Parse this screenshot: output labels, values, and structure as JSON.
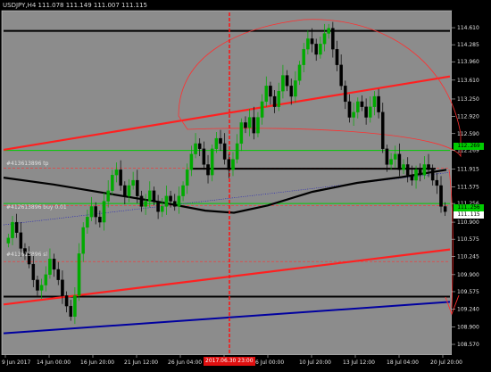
{
  "window": {
    "title": "USDJPY,H4  111.078 111.149 111.007 111.115"
  },
  "colors": {
    "background": "#000000",
    "plot_background": "#8c8c8c",
    "candle_up": "#00aa00",
    "candle_down": "#000000",
    "channel_red": "#ff2020",
    "level_green": "#00cc00",
    "level_black": "#000000",
    "trend_blue": "#0000a0",
    "moving_average": "#000000"
  },
  "order_labels": {
    "tp": "#413613896 tp",
    "buy": "#412613896 buy  0.01",
    "sl": "#413613896 sl"
  },
  "current_price_tags": {
    "upper_green": "112.269",
    "lower_green": "111.256",
    "bid": "111.115"
  },
  "cursor_time_label": "2017.06.30 23:00",
  "chart_data": {
    "type": "candlestick",
    "symbol": "USDJPY",
    "timeframe": "H4",
    "ohlc_header": {
      "open": 111.078,
      "high": 111.149,
      "low": 111.007,
      "close": 111.115
    },
    "y_ticks": [
      "114.610",
      "114.285",
      "113.960",
      "113.610",
      "113.250",
      "112.920",
      "112.590",
      "112.269",
      "111.915",
      "111.575",
      "111.256",
      "110.900",
      "110.575",
      "110.245",
      "109.900",
      "109.575",
      "109.240",
      "108.900",
      "108.570"
    ],
    "x_ticks": [
      "9 Jun 2017",
      "14 Jun 00:00",
      "16 Jun 20:00",
      "21 Jun 12:00",
      "26 Jun 04:00",
      "2017.06.30 23:00",
      "6 Jul 00:00",
      "10 Jul 20:00",
      "13 Jul 12:00",
      "18 Jul 04:00",
      "20 Jul 20:00"
    ],
    "ylim": [
      108.4,
      114.9
    ],
    "levels": [
      {
        "name": "upper-black-resistance",
        "price": 114.55,
        "color": "#000000"
      },
      {
        "name": "upper-green-level",
        "price": 112.269,
        "color": "#00cc00"
      },
      {
        "name": "lower-green-level",
        "price": 111.256,
        "color": "#00cc00"
      },
      {
        "name": "lower-black-support",
        "price": 109.48,
        "color": "#000000"
      }
    ],
    "close_series": [
      110.6,
      110.9,
      110.7,
      110.4,
      110.3,
      110.1,
      109.8,
      109.6,
      109.7,
      109.9,
      110.2,
      110.0,
      109.8,
      109.5,
      109.3,
      109.1,
      109.5,
      110.3,
      110.8,
      111.0,
      111.2,
      111.0,
      110.9,
      111.3,
      111.5,
      111.8,
      111.9,
      111.6,
      111.4,
      111.6,
      111.7,
      111.4,
      111.2,
      111.3,
      111.5,
      111.3,
      111.1,
      111.2,
      111.4,
      111.3,
      111.2,
      111.4,
      111.6,
      111.9,
      112.2,
      112.4,
      112.3,
      112.0,
      111.8,
      112.3,
      112.5,
      112.4,
      112.1,
      111.9,
      112.1,
      112.4,
      112.8,
      112.7,
      112.9,
      112.6,
      112.9,
      113.2,
      113.5,
      113.3,
      113.1,
      113.4,
      113.7,
      113.5,
      113.3,
      113.6,
      113.9,
      114.2,
      114.4,
      114.3,
      114.1,
      114.3,
      114.5,
      114.6,
      114.2,
      113.9,
      113.5,
      113.2,
      112.9,
      113.0,
      113.2,
      113.1,
      112.9,
      113.1,
      113.3,
      113.0,
      112.3,
      112.0,
      112.1,
      112.2,
      111.9,
      112.0,
      111.8,
      111.7,
      111.9,
      111.8,
      112.0,
      111.9,
      111.7,
      111.6,
      111.2,
      111.1
    ]
  }
}
